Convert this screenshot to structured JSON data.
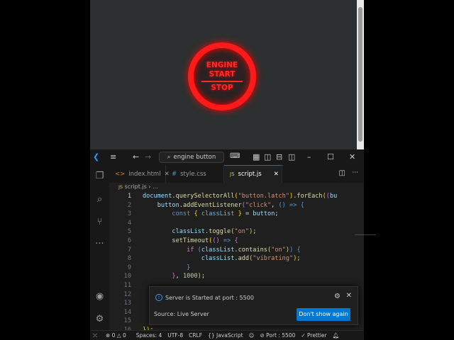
{
  "preview": {
    "button": {
      "line1": "ENGINE",
      "line2": "START",
      "line3": "STOP"
    }
  },
  "titlebar": {
    "search": "engine button"
  },
  "tabs": [
    {
      "label": "index.html",
      "icon": "<>"
    },
    {
      "label": "style.css",
      "icon": "#"
    },
    {
      "label": "script.js",
      "icon": "JS"
    }
  ],
  "breadcrumb": {
    "file": "script.js",
    "rest": "› ...",
    "icon": "JS"
  },
  "code": {
    "line_numbers": [
      "1",
      "2",
      "3",
      "4",
      "5",
      "6",
      "7",
      "8",
      "9",
      "10",
      "11",
      "12",
      "13",
      "14",
      "15",
      "16"
    ]
  },
  "notification": {
    "message": "Server is Started at port : 5500",
    "source": "Source: Live Server",
    "button": "Don't show again"
  },
  "status": {
    "errors": "0",
    "warnings": "0",
    "spaces": "Spaces: 4",
    "encoding": "UTF-8",
    "eol": "CRLF",
    "language": "JavaScript",
    "port": "Port : 5500",
    "formatter": "Prettier"
  },
  "colors": {
    "accent": "#0078d4",
    "engine": "#ff1a1a"
  }
}
